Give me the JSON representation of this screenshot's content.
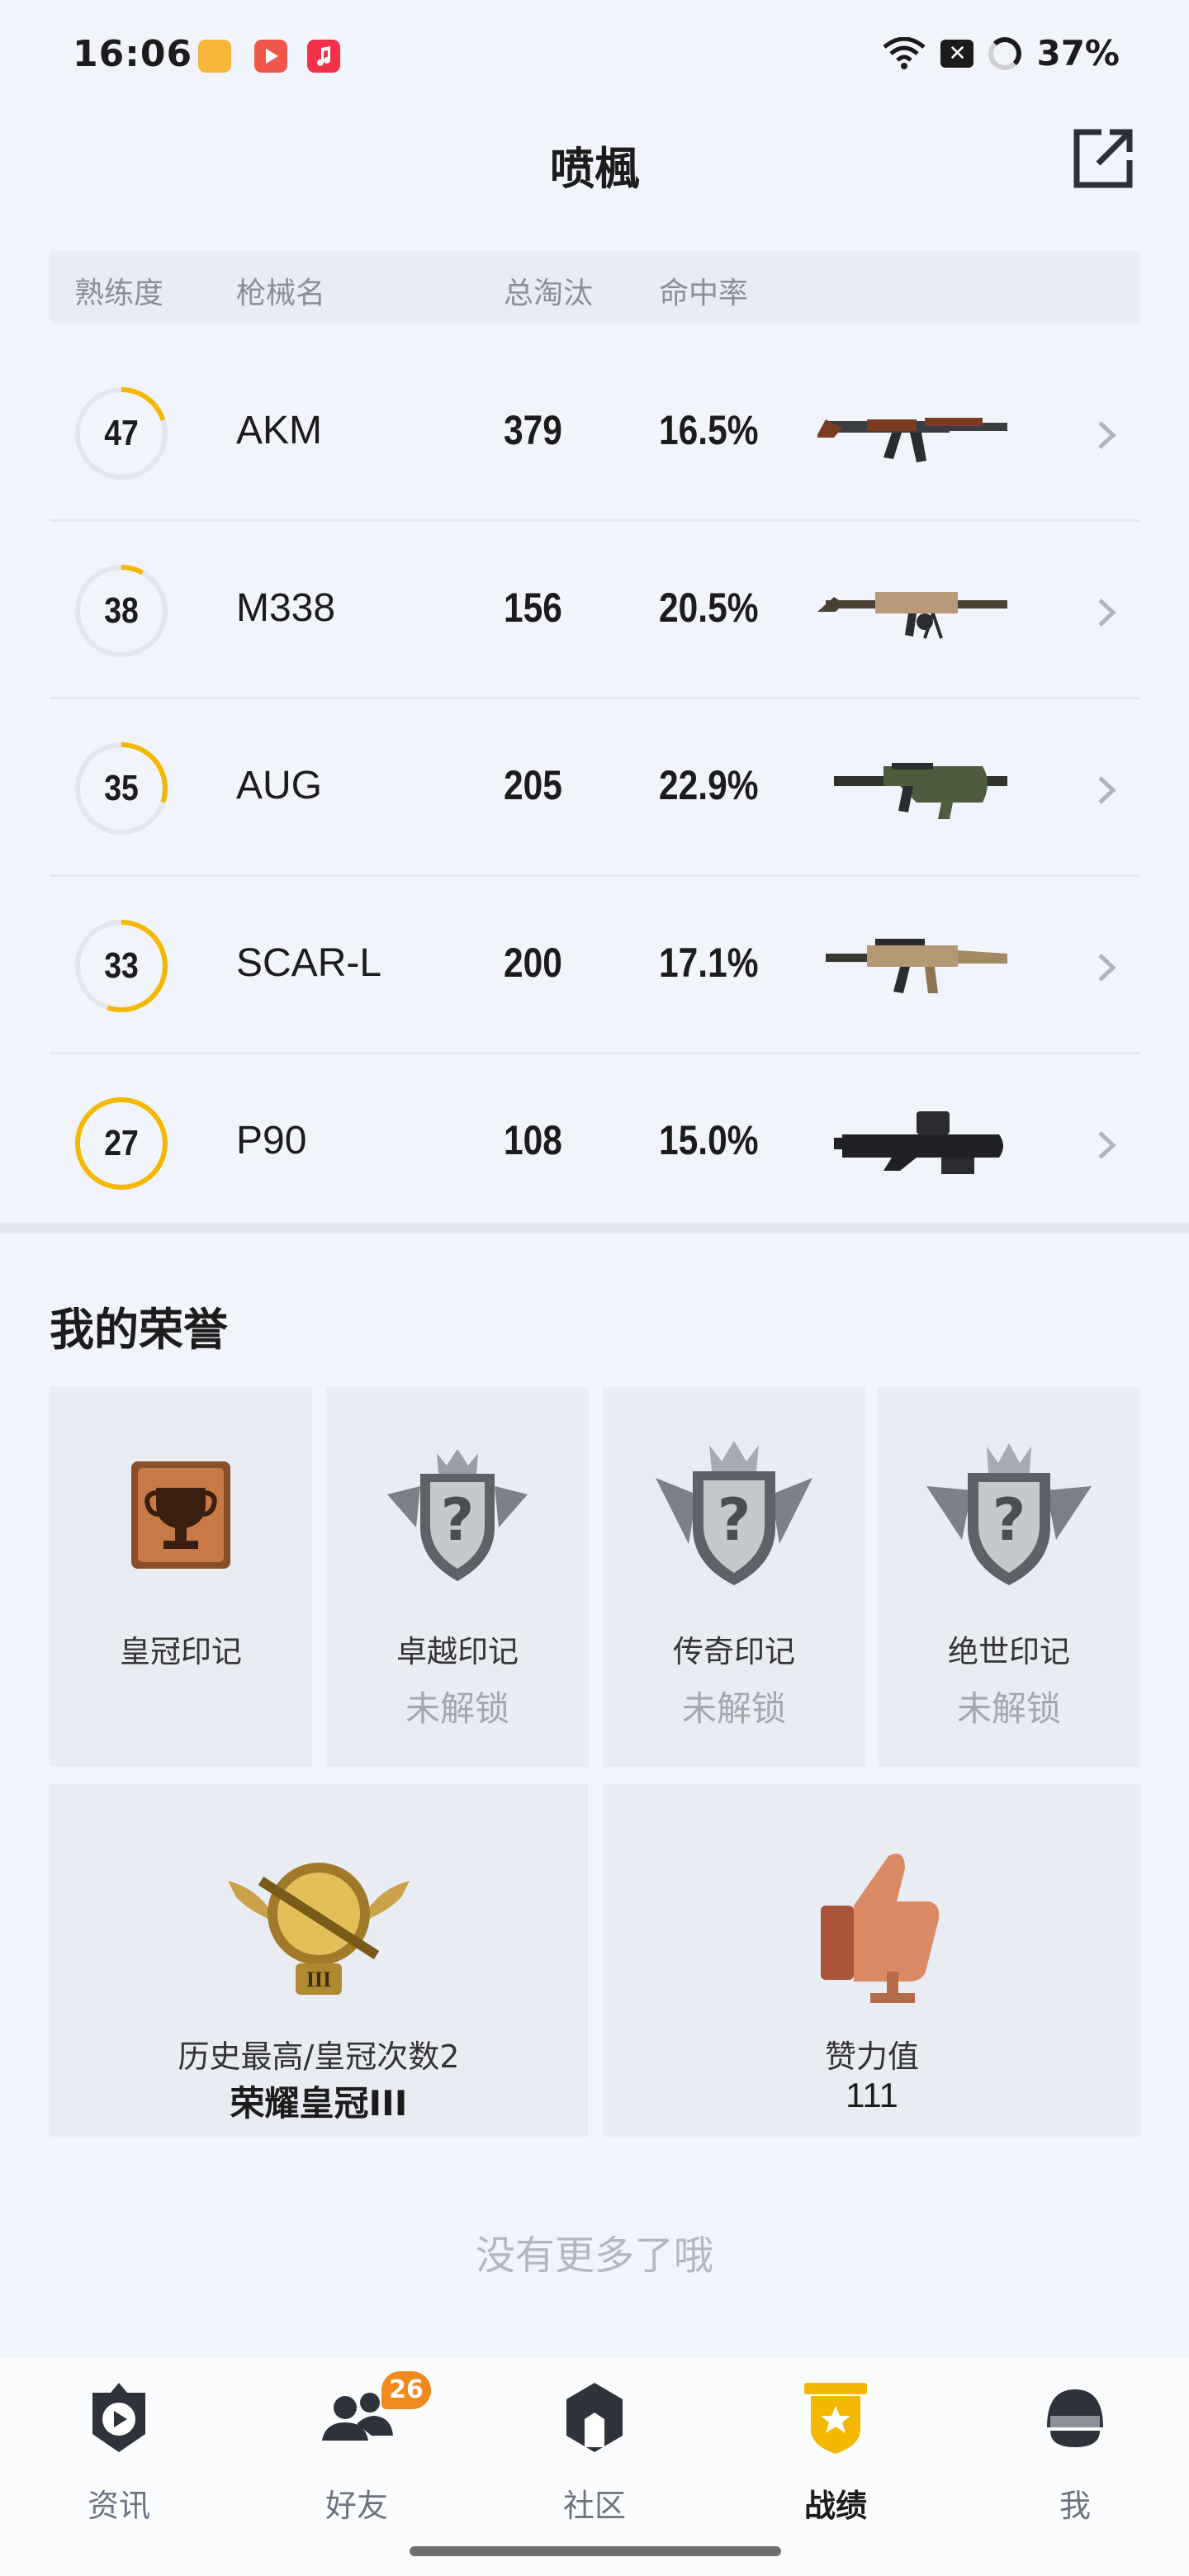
{
  "status_bar": {
    "time": "16:06",
    "app_icons": [
      "books-app-icon",
      "video-app-icon",
      "music-app-icon"
    ],
    "battery": "37%",
    "icons": [
      "wifi-icon",
      "sim-off-icon",
      "battery-ring-icon"
    ]
  },
  "header": {
    "title": "喷楓",
    "share_icon": "share-external-icon"
  },
  "table": {
    "columns": [
      "熟练度",
      "枪械名",
      "总淘汰",
      "命中率"
    ],
    "rows": [
      {
        "level": "47",
        "progress": 0.2,
        "name": "AKM",
        "kills": "379",
        "hit_rate": "16.5%",
        "image": "akm-rifle-image"
      },
      {
        "level": "38",
        "progress": 0.08,
        "name": "M338",
        "kills": "156",
        "hit_rate": "20.5%",
        "image": "m338-rifle-image"
      },
      {
        "level": "35",
        "progress": 0.3,
        "name": "AUG",
        "kills": "205",
        "hit_rate": "22.9%",
        "image": "aug-rifle-image"
      },
      {
        "level": "33",
        "progress": 0.55,
        "name": "SCAR-L",
        "kills": "200",
        "hit_rate": "17.1%",
        "image": "scar-l-rifle-image"
      },
      {
        "level": "27",
        "progress": 1.0,
        "name": "P90",
        "kills": "108",
        "hit_rate": "15.0%",
        "image": "p90-smg-image"
      }
    ]
  },
  "honor": {
    "title": "我的荣誉",
    "badges": [
      {
        "label": "皇冠印记",
        "status": "",
        "icon": "crown-trophy-badge-icon"
      },
      {
        "label": "卓越印记",
        "status": "未解锁",
        "icon": "locked-excellence-badge-icon"
      },
      {
        "label": "传奇印记",
        "status": "未解锁",
        "icon": "locked-legend-badge-icon"
      },
      {
        "label": "绝世印记",
        "status": "未解锁",
        "icon": "locked-peerless-badge-icon"
      }
    ],
    "rank_card": {
      "sub": "历史最高/皇冠次数2",
      "main": "荣耀皇冠III",
      "icon": "crown-rank-emblem-icon",
      "emblem_numeral": "III"
    },
    "likes_card": {
      "sub": "赞力值",
      "main": "111",
      "icon": "thumbs-up-trophy-icon"
    }
  },
  "footer_text": "没有更多了哦",
  "nav": {
    "items": [
      {
        "label": "资讯",
        "icon": "news-icon"
      },
      {
        "label": "好友",
        "icon": "friends-icon",
        "badge": "26"
      },
      {
        "label": "社区",
        "icon": "community-icon"
      },
      {
        "label": "战绩",
        "icon": "record-icon",
        "active": true
      },
      {
        "label": "我",
        "icon": "profile-helmet-icon"
      }
    ]
  },
  "colors": {
    "accent": "#f5b800",
    "background": "#f1f4fa",
    "badge": "#f08a1c"
  }
}
